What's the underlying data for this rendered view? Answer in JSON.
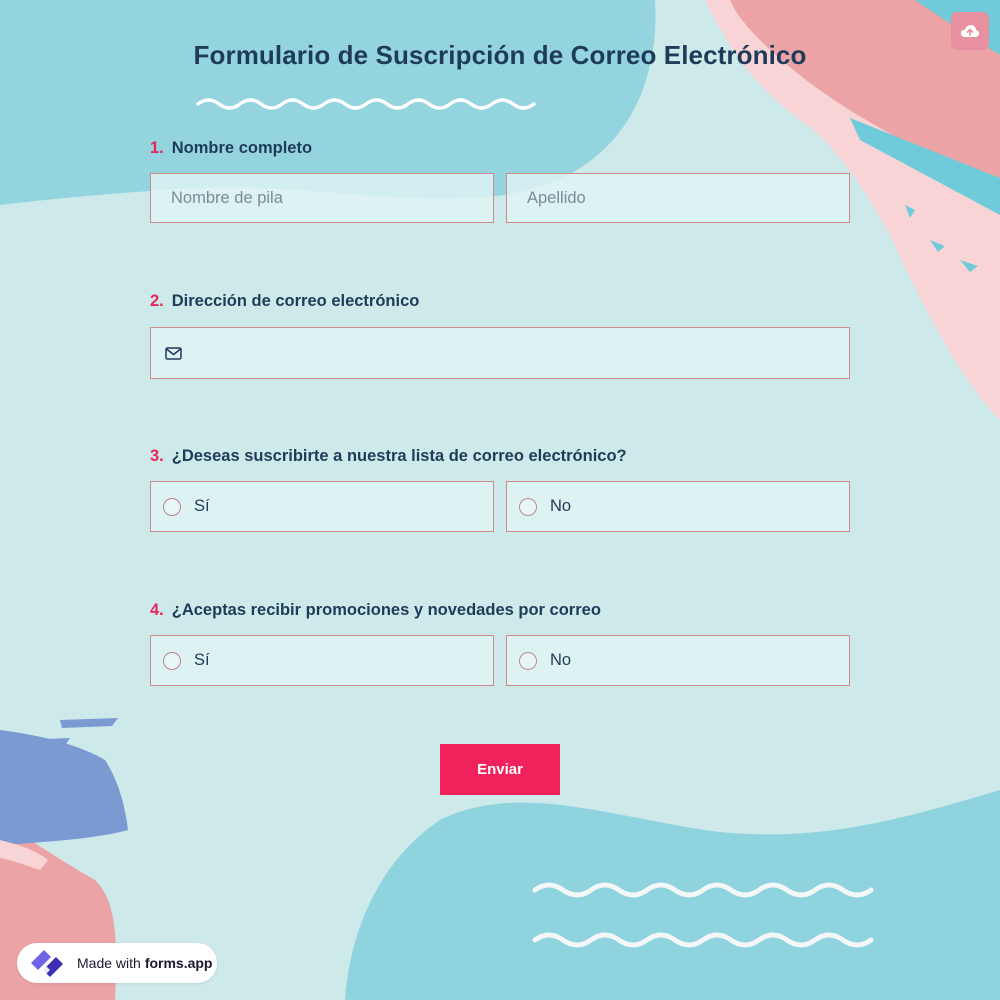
{
  "title": "Formulario de Suscripción de Correo Electrónico",
  "colors": {
    "accent": "#f1215c",
    "text": "#1f3b5a",
    "number": "#e8265e",
    "field_border": "#cf8a8a",
    "background": "#cde9ea"
  },
  "upload_button": {
    "icon": "cloud-upload-icon"
  },
  "questions": [
    {
      "number": "1.",
      "label": "Nombre completo",
      "fields": [
        {
          "placeholder": "Nombre de pila"
        },
        {
          "placeholder": "Apellido"
        }
      ]
    },
    {
      "number": "2.",
      "label": "Dirección de correo electrónico",
      "icon": "envelope-icon",
      "value": ""
    },
    {
      "number": "3.",
      "label": "¿Deseas suscribirte a nuestra lista de correo electrónico?",
      "options": [
        "Sí",
        "No"
      ]
    },
    {
      "number": "4.",
      "label": "¿Aceptas recibir promociones y novedades por correo",
      "options": [
        "Sí",
        "No"
      ]
    }
  ],
  "submit_label": "Enviar",
  "badge": {
    "prefix": "Made with",
    "brand": "forms.app",
    "icon": "forms-app-logo"
  }
}
